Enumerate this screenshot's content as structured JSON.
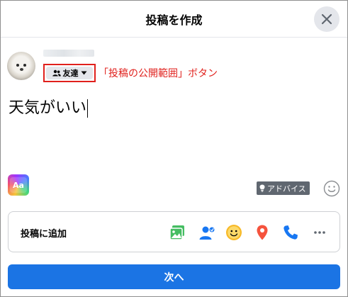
{
  "header": {
    "title": "投稿を作成",
    "close_icon": "close-icon"
  },
  "user": {
    "privacy_label": "友達",
    "privacy_icon": "friends-icon",
    "dropdown_icon": "caret-down-icon"
  },
  "annotation": "「投稿の公開範囲」ボタン",
  "composer": {
    "text": "天気がいい"
  },
  "background_selector": {
    "label": "Aa"
  },
  "advice": {
    "label": "アドバイス",
    "icon": "lightbulb-icon"
  },
  "add_to_post": {
    "label": "投稿に追加",
    "icons": [
      "photo-video-icon",
      "tag-people-icon",
      "feeling-icon",
      "check-in-icon",
      "call-icon",
      "more-icon"
    ]
  },
  "next_button": {
    "label": "次へ"
  },
  "colors": {
    "primary": "#1b74e4",
    "annotation": "#e0201c",
    "photo": "#45bd62",
    "tag": "#1877f2",
    "feeling": "#f7b928",
    "checkin": "#f5533d"
  }
}
